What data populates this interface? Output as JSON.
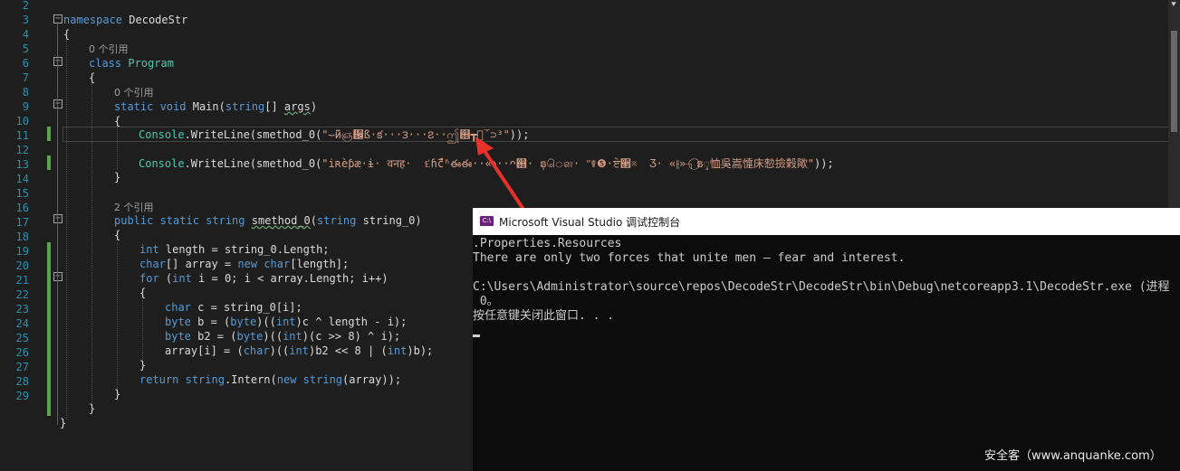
{
  "editor": {
    "line_numbers": [
      "2",
      "3",
      "4",
      "5",
      "6",
      "7",
      "8",
      "9",
      "10",
      "11",
      "12",
      "13",
      "14",
      "15",
      "16",
      "17",
      "18",
      "19",
      "20",
      "21",
      "22",
      "23",
      "24",
      "25",
      "26",
      "27",
      "28",
      "29"
    ],
    "ref_zero": "0 个引用",
    "ref_two": "2 个引用",
    "ns_kw": "namespace",
    "ns_name": "DecodeStr",
    "brace_open": "{",
    "brace_close": "}",
    "class_kw": "class",
    "class_name": "Program",
    "main_kw": "static void",
    "main_name": "Main",
    "main_param_type": "string",
    "main_param_rest": "[] ",
    "main_param_name": "args",
    "close_paren": ")",
    "console_type": "Console",
    "writeline": ".WriteLine(smethod_0(",
    "string_1": "\"؅̃ӥஞ᪜ß·క···౩···౭··ဤ஛┳ஜ̅´⊃³\"",
    "line9_tail": "));",
    "string_2": "\"iʀèƥæ·ɨ· वनह·  દɦćืʱఈఈ··«⬧··ᴖ஛· ٖຣௌ· ʺ☤❺·ਏ੢※  Ʒ· «⫲»┐⃝ຣᮣ恤吳嵩懥床愸撿榖歟\"",
    "line11_tail": "));",
    "method_mods": "public static",
    "method_ret": "string",
    "method_name": "smethod_0",
    "method_param_type": "string",
    "method_param_name": "string_0",
    "l16_type": "int",
    "l16_rest": " length = string_0.Length;",
    "l17_type": "char",
    "l17_mid": "[] array = ",
    "l17_new": "new",
    "l17_type2": "char",
    "l17_end": "[length];",
    "l18_for": "for",
    "l18_open": " (",
    "l18_int": "int",
    "l18_rest": " i = 0; i < array.Length; i++)",
    "l20_type": "char",
    "l20_rest": " c = string_0[i];",
    "l21_type": "byte",
    "l21_mid": " b = (",
    "l21_cast": "byte",
    "l21_mid2": ")((",
    "l21_int": "int",
    "l21_end": ")c ^ length - i);",
    "l22_type": "byte",
    "l22_mid": " b2 = (",
    "l22_cast": "byte",
    "l22_mid2": ")((",
    "l22_int": "int",
    "l22_end": ")(c >> 8) ^ i);",
    "l23_start": "array[i] = (",
    "l23_char": "char",
    "l23_mid": ")((",
    "l23_int": "int",
    "l23_mid2": ")b2 << 8 | (",
    "l23_int2": "int",
    "l23_end": ")b);",
    "l25_return": "return",
    "l25_string": "string",
    "l25_mid": ".Intern(",
    "l25_new": "new",
    "l25_string2": "string",
    "l25_end": "(array));"
  },
  "console": {
    "title": "Microsoft Visual Studio 调试控制台",
    "icon_label": "C:\\",
    "lines": [
      ".Properties.Resources",
      "There are only two forces that unite men – fear and interest.",
      "",
      "C:\\Users\\Administrator\\source\\repos\\DecodeStr\\DecodeStr\\bin\\Debug\\netcoreapp3.1\\DecodeStr.exe (进程",
      " 0。",
      "按任意键关闭此窗口. . ."
    ]
  },
  "watermark": "安全客（www.anquanke.com）",
  "colors": {
    "editor_bg": "#1e1e1e",
    "keyword": "#569cd6",
    "type": "#4ec9b0",
    "string": "#d69d85",
    "line_number": "#2b91af",
    "console_bg": "#0c0c0c",
    "arrow": "#e8312a"
  }
}
